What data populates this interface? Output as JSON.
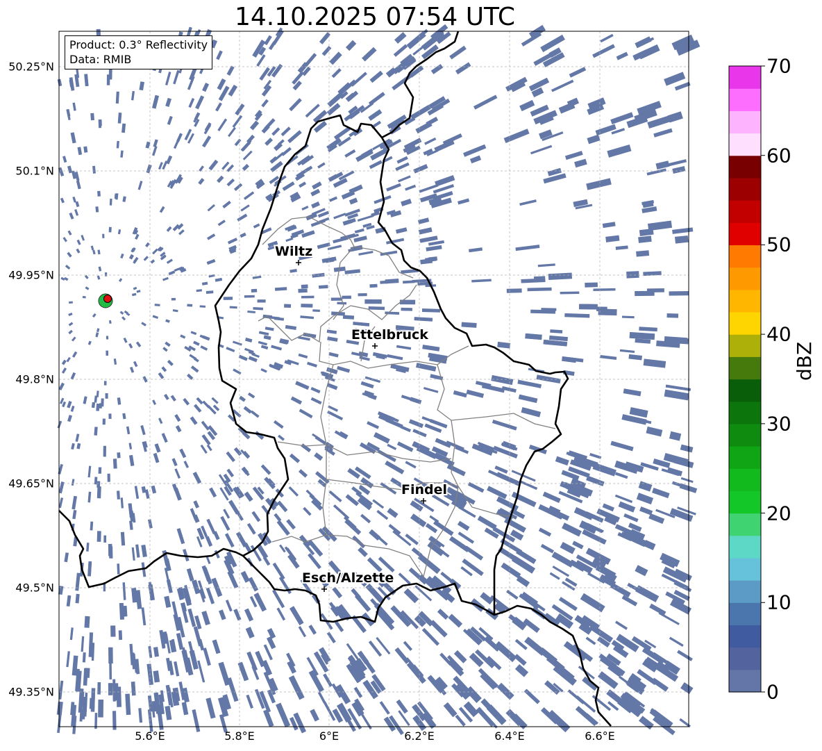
{
  "title": "14.10.2025 07:54 UTC",
  "info": {
    "product": "Product: 0.3° Reflectivity",
    "data_source": "Data: RMIB"
  },
  "map": {
    "lat_ticks": [
      "50.25°N",
      "50.1°N",
      "49.95°N",
      "49.8°N",
      "49.65°N",
      "49.5°N",
      "49.35°N"
    ],
    "lon_ticks": [
      "5.6°E",
      "5.8°E",
      "6°E",
      "6.2°E",
      "6.4°E",
      "6.6°E"
    ],
    "cities": [
      {
        "name": "Wiltz"
      },
      {
        "name": "Ettelbruck"
      },
      {
        "name": "Findel"
      },
      {
        "name": "Esch/Alzette"
      }
    ],
    "radar_marker": "radar-site-icon",
    "echo_color": "#6478a8",
    "border_color": "#000000",
    "canton_color": "#808080"
  },
  "colorbar": {
    "label": "dBZ",
    "ticks": [
      "0",
      "10",
      "20",
      "30",
      "40",
      "50",
      "60",
      "70"
    ],
    "colors": [
      "#6476a8",
      "#52639e",
      "#415ba0",
      "#4b76ad",
      "#5b9bc5",
      "#66c2da",
      "#5ed8c6",
      "#40d372",
      "#13c728",
      "#12ba1e",
      "#10a514",
      "#0f8c0f",
      "#0c750c",
      "#095f09",
      "#477a0c",
      "#adb008",
      "#fed500",
      "#feb600",
      "#fe9900",
      "#fe7a00",
      "#e10000",
      "#c20000",
      "#9d0000",
      "#780000",
      "#fedffe",
      "#feb3fe",
      "#fe6efe",
      "#ea36ea"
    ]
  }
}
